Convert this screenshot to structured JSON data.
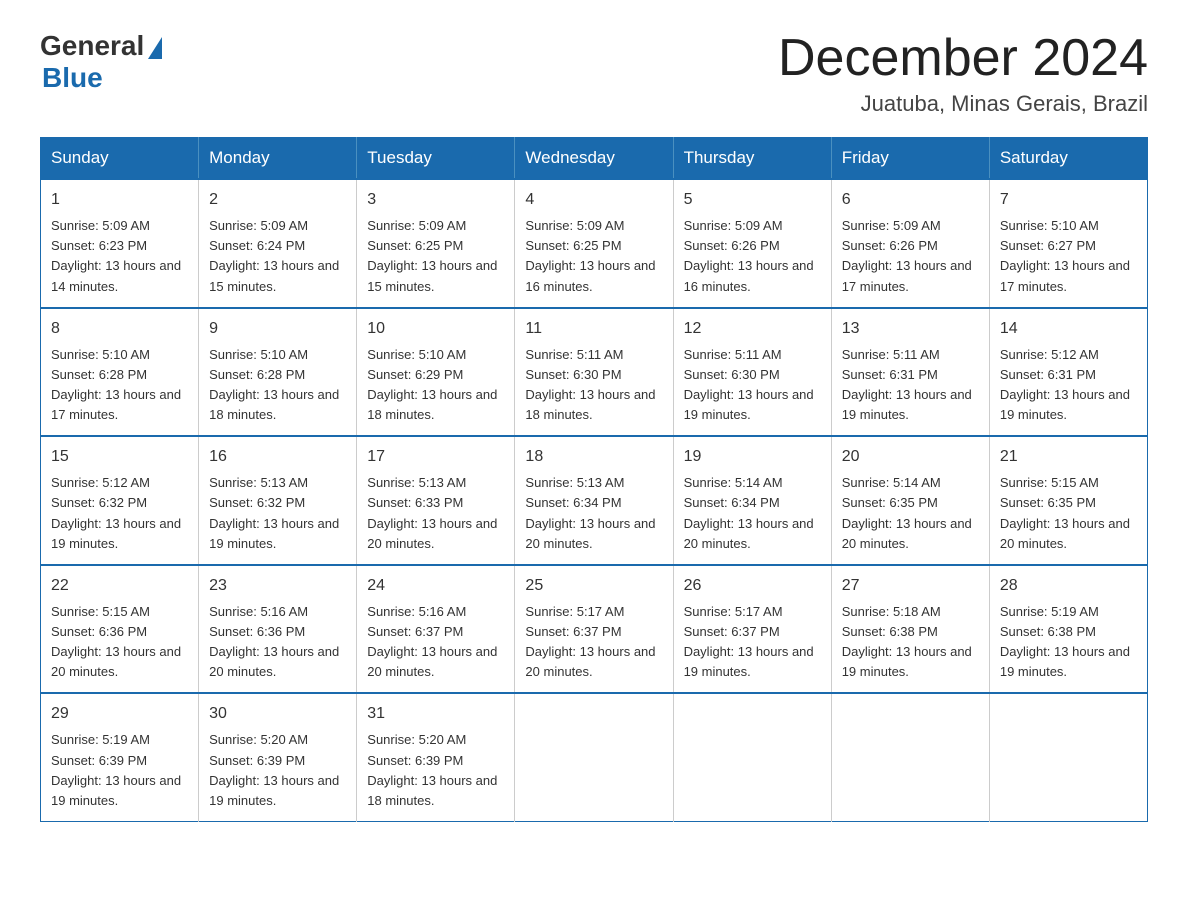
{
  "logo": {
    "general": "General",
    "blue": "Blue"
  },
  "header": {
    "month": "December 2024",
    "location": "Juatuba, Minas Gerais, Brazil"
  },
  "weekdays": [
    "Sunday",
    "Monday",
    "Tuesday",
    "Wednesday",
    "Thursday",
    "Friday",
    "Saturday"
  ],
  "weeks": [
    [
      {
        "day": "1",
        "sunrise": "5:09 AM",
        "sunset": "6:23 PM",
        "daylight": "13 hours and 14 minutes."
      },
      {
        "day": "2",
        "sunrise": "5:09 AM",
        "sunset": "6:24 PM",
        "daylight": "13 hours and 15 minutes."
      },
      {
        "day": "3",
        "sunrise": "5:09 AM",
        "sunset": "6:25 PM",
        "daylight": "13 hours and 15 minutes."
      },
      {
        "day": "4",
        "sunrise": "5:09 AM",
        "sunset": "6:25 PM",
        "daylight": "13 hours and 16 minutes."
      },
      {
        "day": "5",
        "sunrise": "5:09 AM",
        "sunset": "6:26 PM",
        "daylight": "13 hours and 16 minutes."
      },
      {
        "day": "6",
        "sunrise": "5:09 AM",
        "sunset": "6:26 PM",
        "daylight": "13 hours and 17 minutes."
      },
      {
        "day": "7",
        "sunrise": "5:10 AM",
        "sunset": "6:27 PM",
        "daylight": "13 hours and 17 minutes."
      }
    ],
    [
      {
        "day": "8",
        "sunrise": "5:10 AM",
        "sunset": "6:28 PM",
        "daylight": "13 hours and 17 minutes."
      },
      {
        "day": "9",
        "sunrise": "5:10 AM",
        "sunset": "6:28 PM",
        "daylight": "13 hours and 18 minutes."
      },
      {
        "day": "10",
        "sunrise": "5:10 AM",
        "sunset": "6:29 PM",
        "daylight": "13 hours and 18 minutes."
      },
      {
        "day": "11",
        "sunrise": "5:11 AM",
        "sunset": "6:30 PM",
        "daylight": "13 hours and 18 minutes."
      },
      {
        "day": "12",
        "sunrise": "5:11 AM",
        "sunset": "6:30 PM",
        "daylight": "13 hours and 19 minutes."
      },
      {
        "day": "13",
        "sunrise": "5:11 AM",
        "sunset": "6:31 PM",
        "daylight": "13 hours and 19 minutes."
      },
      {
        "day": "14",
        "sunrise": "5:12 AM",
        "sunset": "6:31 PM",
        "daylight": "13 hours and 19 minutes."
      }
    ],
    [
      {
        "day": "15",
        "sunrise": "5:12 AM",
        "sunset": "6:32 PM",
        "daylight": "13 hours and 19 minutes."
      },
      {
        "day": "16",
        "sunrise": "5:13 AM",
        "sunset": "6:32 PM",
        "daylight": "13 hours and 19 minutes."
      },
      {
        "day": "17",
        "sunrise": "5:13 AM",
        "sunset": "6:33 PM",
        "daylight": "13 hours and 20 minutes."
      },
      {
        "day": "18",
        "sunrise": "5:13 AM",
        "sunset": "6:34 PM",
        "daylight": "13 hours and 20 minutes."
      },
      {
        "day": "19",
        "sunrise": "5:14 AM",
        "sunset": "6:34 PM",
        "daylight": "13 hours and 20 minutes."
      },
      {
        "day": "20",
        "sunrise": "5:14 AM",
        "sunset": "6:35 PM",
        "daylight": "13 hours and 20 minutes."
      },
      {
        "day": "21",
        "sunrise": "5:15 AM",
        "sunset": "6:35 PM",
        "daylight": "13 hours and 20 minutes."
      }
    ],
    [
      {
        "day": "22",
        "sunrise": "5:15 AM",
        "sunset": "6:36 PM",
        "daylight": "13 hours and 20 minutes."
      },
      {
        "day": "23",
        "sunrise": "5:16 AM",
        "sunset": "6:36 PM",
        "daylight": "13 hours and 20 minutes."
      },
      {
        "day": "24",
        "sunrise": "5:16 AM",
        "sunset": "6:37 PM",
        "daylight": "13 hours and 20 minutes."
      },
      {
        "day": "25",
        "sunrise": "5:17 AM",
        "sunset": "6:37 PM",
        "daylight": "13 hours and 20 minutes."
      },
      {
        "day": "26",
        "sunrise": "5:17 AM",
        "sunset": "6:37 PM",
        "daylight": "13 hours and 19 minutes."
      },
      {
        "day": "27",
        "sunrise": "5:18 AM",
        "sunset": "6:38 PM",
        "daylight": "13 hours and 19 minutes."
      },
      {
        "day": "28",
        "sunrise": "5:19 AM",
        "sunset": "6:38 PM",
        "daylight": "13 hours and 19 minutes."
      }
    ],
    [
      {
        "day": "29",
        "sunrise": "5:19 AM",
        "sunset": "6:39 PM",
        "daylight": "13 hours and 19 minutes."
      },
      {
        "day": "30",
        "sunrise": "5:20 AM",
        "sunset": "6:39 PM",
        "daylight": "13 hours and 19 minutes."
      },
      {
        "day": "31",
        "sunrise": "5:20 AM",
        "sunset": "6:39 PM",
        "daylight": "13 hours and 18 minutes."
      },
      null,
      null,
      null,
      null
    ]
  ]
}
